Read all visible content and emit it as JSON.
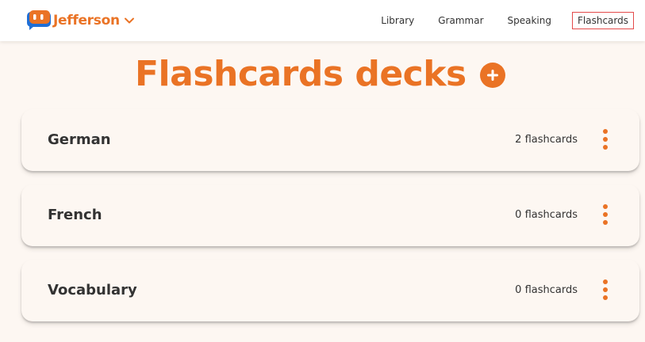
{
  "app": {
    "brand_name": "Jefferson"
  },
  "nav": {
    "items": [
      {
        "label": "Library"
      },
      {
        "label": "Grammar"
      },
      {
        "label": "Speaking"
      },
      {
        "label": "Flashcards",
        "active": true
      }
    ]
  },
  "main": {
    "title": "Flashcards decks",
    "decks": [
      {
        "name": "German",
        "count": "2 flashcards"
      },
      {
        "name": "French",
        "count": "0 flashcards"
      },
      {
        "name": "Vocabulary",
        "count": "0 flashcards"
      }
    ]
  },
  "colors": {
    "accent": "#ea7325",
    "logo_blue": "#1f6fd6",
    "background": "#fdf7f2",
    "active_outline": "#e34b4b"
  },
  "icons": {
    "logo": "jefferson-logo-icon",
    "brand_dropdown": "chevron-down-icon",
    "add_deck": "plus-circle-icon",
    "deck_menu": "kebab-menu-icon"
  }
}
